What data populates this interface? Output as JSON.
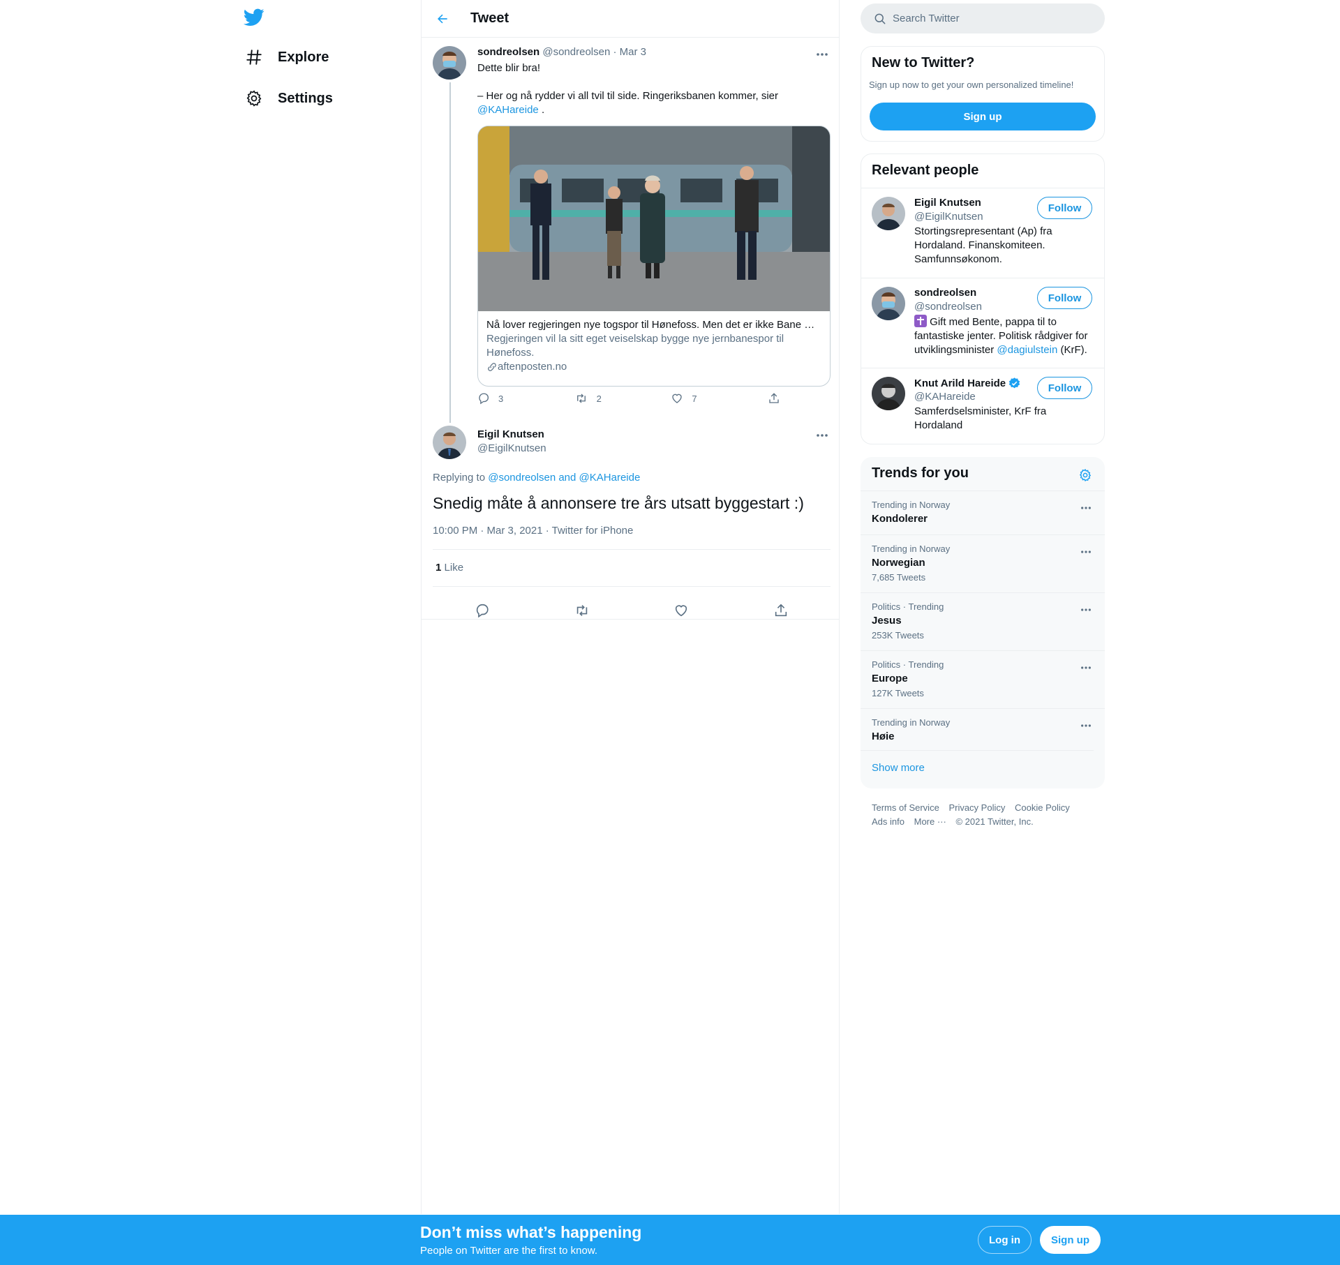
{
  "nav": {
    "items": [
      {
        "label": "Explore",
        "icon": "hashtag-icon"
      },
      {
        "label": "Settings",
        "icon": "gear-icon"
      }
    ]
  },
  "header": {
    "title": "Tweet"
  },
  "tweet1": {
    "name": "sondreolsen",
    "handle": "@sondreolsen",
    "date": "· Mar 3",
    "line1": "Dette blir bra!",
    "line2": "– Her og nå rydder vi all tvil til side. Ringeriksbanen kommer, sier",
    "mention": "@KAHareide",
    "after_mention": ".",
    "card": {
      "title": "Nå lover regjeringen nye togspor til Hønefoss. Men det er ikke Bane NOR som skal bygge.",
      "description": "Regjeringen vil la sitt eget veiselskap bygge nye jernbanespor til Hønefoss.",
      "domain": "aftenposten.no"
    },
    "counts": {
      "replies": "3",
      "retweets": "2",
      "likes": "7"
    }
  },
  "tweet2": {
    "name": "Eigil Knutsen",
    "handle": "@EigilKnutsen",
    "replying_prefix": "Replying to",
    "replying_to": "@sondreolsen and @KAHareide",
    "text": "Snedig måte å annonsere tre års utsatt byggestart :)",
    "meta": "10:00 PM · Mar 3, 2021 · Twitter for iPhone",
    "likes_count": "1",
    "likes_label": "Like"
  },
  "search": {
    "placeholder": "Search Twitter"
  },
  "new_box": {
    "title": "New to Twitter?",
    "subtitle": "Sign up now to get your own personalized timeline!",
    "signup": "Sign up"
  },
  "relevant": {
    "title": "Relevant people",
    "follow_label": "Follow",
    "people": [
      {
        "name": "Eigil Knutsen",
        "handle": "@EigilKnutsen",
        "bio": "Stortingsrepresentant (Ap) fra Hordaland. Finanskomiteen. Samfunnsøkonom."
      },
      {
        "name": "sondreolsen",
        "handle": "@sondreolsen",
        "bio_pre": "Gift med Bente, pappa til to fantastiske jenter. Politisk rådgiver for utviklingsminister",
        "bio_mention": "@dagiulstein",
        "bio_post": "(KrF)."
      },
      {
        "name": "Knut Arild Hareide",
        "handle": "@KAHareide",
        "bio": "Samferdselsminister, KrF fra Hordaland"
      }
    ]
  },
  "trends": {
    "title": "Trends for you",
    "items": [
      {
        "category": "Trending in Norway",
        "name": "Kondolerer",
        "count": ""
      },
      {
        "category": "Trending in Norway",
        "name": "Norwegian",
        "count": "7,685 Tweets"
      },
      {
        "category": "Politics · Trending",
        "name": "Jesus",
        "count": "253K Tweets"
      },
      {
        "category": "Politics · Trending",
        "name": "Europe",
        "count": "127K Tweets"
      },
      {
        "category": "Trending in Norway",
        "name": "Høie",
        "count": ""
      }
    ],
    "show_more": "Show more"
  },
  "footer": {
    "links": [
      "Terms of Service",
      "Privacy Policy",
      "Cookie Policy",
      "Ads info",
      "More ···",
      "© 2021 Twitter, Inc."
    ]
  },
  "bottom_bar": {
    "title": "Don’t miss what’s happening",
    "subtitle": "People on Twitter are the first to know.",
    "login": "Log in",
    "signup": "Sign up"
  },
  "colors": {
    "accent": "#1da1f2",
    "link": "#1b95e0",
    "muted": "#5b7083",
    "border": "#ebeef0"
  }
}
